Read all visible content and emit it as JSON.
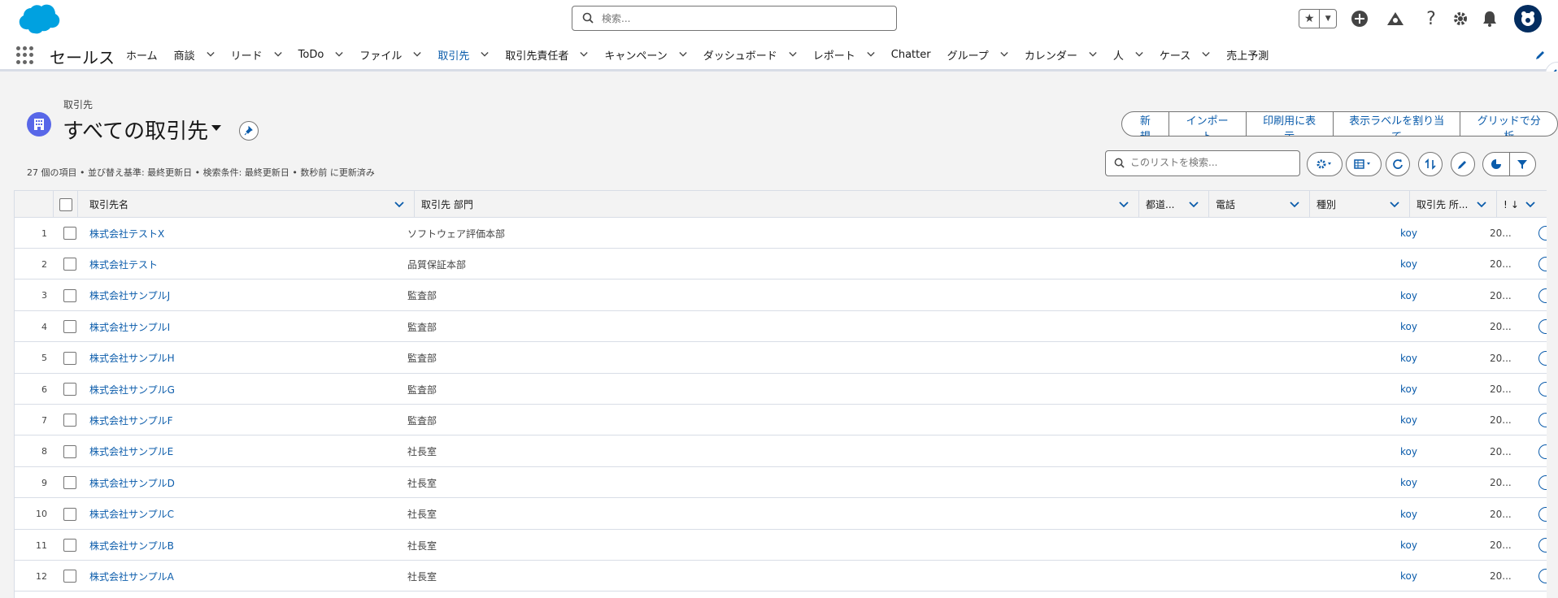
{
  "global_header": {
    "search_placeholder": "検索...",
    "icons": [
      "star-icon",
      "chevron-down-icon",
      "plus-icon",
      "trailhead-icon",
      "help-icon",
      "gear-icon",
      "bell-icon",
      "avatar-icon"
    ]
  },
  "nav": {
    "app_name": "セールス",
    "items": [
      {
        "label": "ホーム",
        "has_menu": false
      },
      {
        "label": "商談",
        "has_menu": true
      },
      {
        "label": "リード",
        "has_menu": true
      },
      {
        "label": "ToDo",
        "has_menu": true
      },
      {
        "label": "ファイル",
        "has_menu": true
      },
      {
        "label": "取引先",
        "has_menu": true,
        "active": true
      },
      {
        "label": "取引先責任者",
        "has_menu": true
      },
      {
        "label": "キャンペーン",
        "has_menu": true
      },
      {
        "label": "ダッシュボード",
        "has_menu": true
      },
      {
        "label": "レポート",
        "has_menu": true
      },
      {
        "label": "Chatter",
        "has_menu": false
      },
      {
        "label": "グループ",
        "has_menu": true
      },
      {
        "label": "カレンダー",
        "has_menu": true
      },
      {
        "label": "人",
        "has_menu": true
      },
      {
        "label": "ケース",
        "has_menu": true
      },
      {
        "label": "売上予測",
        "has_menu": false
      }
    ]
  },
  "list_view": {
    "object_label": "取引先",
    "title": "すべての取引先",
    "buttons": [
      "新規",
      "インポート",
      "印刷用に表示",
      "表示ラベルを割り当て",
      "グリッドで分析"
    ],
    "info": "27 個の項目 • 並び替え基準: 最終更新日 • 検索条件: 最終更新日 • 数秒前 に更新済み",
    "search_placeholder": "このリストを検索..."
  },
  "table": {
    "columns": [
      "取引先名",
      "取引先 部門",
      "都道...",
      "電話",
      "種別",
      "取引先 所...",
      "!"
    ],
    "rows": [
      {
        "num": "1",
        "name": "株式会社テストX",
        "dept": "ソフトウェア評価本部",
        "owner": "koy",
        "date": "20..."
      },
      {
        "num": "2",
        "name": "株式会社テスト",
        "dept": "品質保証本部",
        "owner": "koy",
        "date": "20..."
      },
      {
        "num": "3",
        "name": "株式会社サンプルJ",
        "dept": "監査部",
        "owner": "koy",
        "date": "20..."
      },
      {
        "num": "4",
        "name": "株式会社サンプルI",
        "dept": "監査部",
        "owner": "koy",
        "date": "20..."
      },
      {
        "num": "5",
        "name": "株式会社サンプルH",
        "dept": "監査部",
        "owner": "koy",
        "date": "20..."
      },
      {
        "num": "6",
        "name": "株式会社サンプルG",
        "dept": "監査部",
        "owner": "koy",
        "date": "20..."
      },
      {
        "num": "7",
        "name": "株式会社サンプルF",
        "dept": "監査部",
        "owner": "koy",
        "date": "20..."
      },
      {
        "num": "8",
        "name": "株式会社サンプルE",
        "dept": "社長室",
        "owner": "koy",
        "date": "20..."
      },
      {
        "num": "9",
        "name": "株式会社サンプルD",
        "dept": "社長室",
        "owner": "koy",
        "date": "20..."
      },
      {
        "num": "10",
        "name": "株式会社サンプルC",
        "dept": "社長室",
        "owner": "koy",
        "date": "20..."
      },
      {
        "num": "11",
        "name": "株式会社サンプルB",
        "dept": "社長室",
        "owner": "koy",
        "date": "20..."
      },
      {
        "num": "12",
        "name": "株式会社サンプルA",
        "dept": "社長室",
        "owner": "koy",
        "date": "20..."
      }
    ]
  },
  "colors": {
    "brand": "#0b5cab",
    "account_icon": "#5867e8",
    "cloud": "#00a1e0",
    "avatar": "#032d60"
  }
}
